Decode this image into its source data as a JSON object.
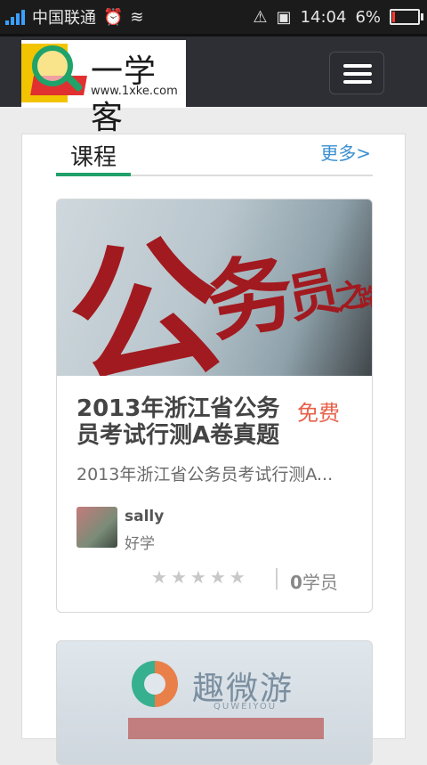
{
  "status_bar": {
    "carrier": "中国联通",
    "time": "14:04",
    "battery": "6%"
  },
  "header": {
    "logo_name": "一学客",
    "logo_url": "www.1xke.com"
  },
  "section": {
    "title": "课程",
    "more": "更多>"
  },
  "course": {
    "cover_text": [
      "公",
      "务",
      "员",
      "之",
      "路"
    ],
    "title": "2013年浙江省公务员考试行测A卷真题",
    "price": "免费",
    "description": "2013年浙江省公务员考试行测A...",
    "author": "sally",
    "author_tag": "好学",
    "rating": 0,
    "rating_max": 5,
    "students_count": "0",
    "students_label": "学员"
  },
  "next_course": {
    "brand": "趣微游",
    "brand_sub": "QUWEIYOU"
  },
  "colors": {
    "accent_green": "#20a06a",
    "link_blue": "#3a8fd0",
    "price_orange": "#e7604a",
    "header_bg": "#2d2f35"
  }
}
